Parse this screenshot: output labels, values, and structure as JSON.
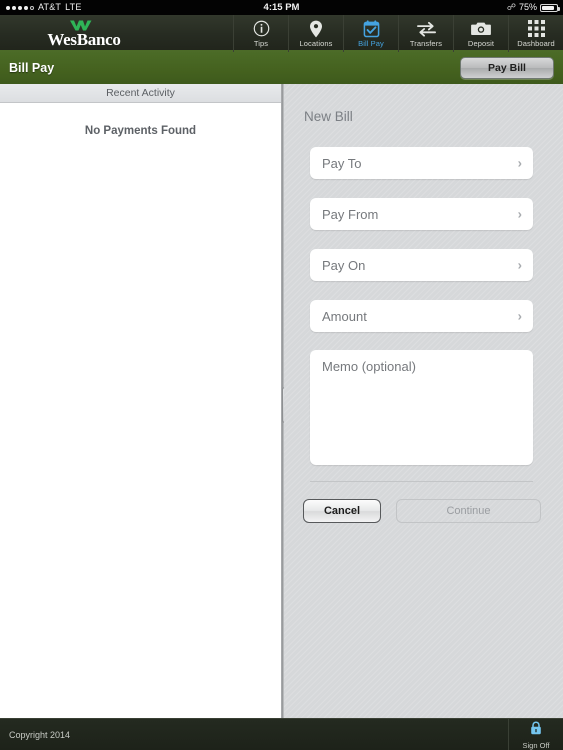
{
  "status_bar": {
    "carrier": "AT&T",
    "network": "LTE",
    "time": "4:15 PM",
    "battery_percent": "75%",
    "bluetooth_icon": "bluetooth-icon",
    "battery_icon": "battery-icon",
    "signal_icon": "signal-dots-icon"
  },
  "header": {
    "brand": "WesBanco",
    "brand_mark_icon": "wesbanco-chevron-logo",
    "nav": [
      {
        "label": "Tips",
        "icon": "info-circle-icon",
        "active": false
      },
      {
        "label": "Locations",
        "icon": "map-pin-icon",
        "active": false
      },
      {
        "label": "Bill Pay",
        "icon": "calendar-check-icon",
        "active": true
      },
      {
        "label": "Transfers",
        "icon": "transfer-arrows-icon",
        "active": false
      },
      {
        "label": "Deposit",
        "icon": "camera-icon",
        "active": false
      },
      {
        "label": "Dashboard",
        "icon": "grid-icon",
        "active": false
      }
    ]
  },
  "title_bar": {
    "title": "Bill Pay",
    "pay_bill_label": "Pay Bill"
  },
  "left_pane": {
    "section_header": "Recent Activity",
    "empty_message": "No Payments Found"
  },
  "right_pane": {
    "section_title": "New Bill",
    "fields": [
      {
        "label": "Pay To",
        "chevron": "chevron-right-icon"
      },
      {
        "label": "Pay From",
        "chevron": "chevron-right-icon"
      },
      {
        "label": "Pay On",
        "chevron": "chevron-right-icon"
      },
      {
        "label": "Amount",
        "chevron": "chevron-right-icon"
      }
    ],
    "memo_placeholder": "Memo (optional)",
    "cancel_label": "Cancel",
    "continue_label": "Continue"
  },
  "footer": {
    "copyright": "Copyright 2014",
    "signoff_label": "Sign Off",
    "signoff_icon": "lock-icon"
  },
  "colors": {
    "header_dark": "#272c22",
    "accent_green": "#45621f",
    "accent_line": "#4c6b28",
    "active_tab_blue": "#45a3e0",
    "right_pane_bg": "#d6d8da",
    "lock_blue": "#74c5ef"
  }
}
